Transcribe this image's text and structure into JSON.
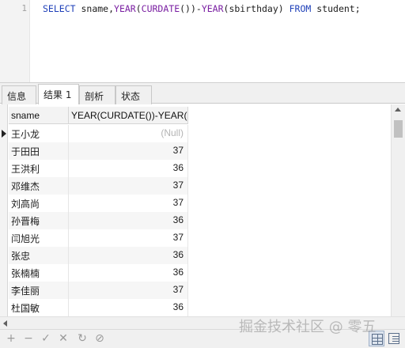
{
  "editor": {
    "line_number": "1",
    "sql": {
      "select": "SELECT",
      "columns": " sname,",
      "year_fn1": "YEAR",
      "open1": "(",
      "curdate_fn": "CURDATE",
      "call": "())-",
      "year_fn2": "YEAR",
      "arg": "(sbirthday) ",
      "from": "FROM",
      "table": " student;"
    }
  },
  "tabs": [
    {
      "label": "信息"
    },
    {
      "label": "结果 1",
      "active": true
    },
    {
      "label": "剖析"
    },
    {
      "label": "状态"
    }
  ],
  "grid": {
    "columns": [
      "sname",
      "YEAR(CURDATE())-YEAR(s"
    ],
    "rows": [
      {
        "sname": "王小龙",
        "age": "(Null)",
        "is_null": true
      },
      {
        "sname": "于田田",
        "age": "37"
      },
      {
        "sname": "王洪利",
        "age": "36"
      },
      {
        "sname": "邓维杰",
        "age": "37"
      },
      {
        "sname": "刘高尚",
        "age": "37"
      },
      {
        "sname": "孙晋梅",
        "age": "36"
      },
      {
        "sname": "闫旭光",
        "age": "37"
      },
      {
        "sname": "张忠",
        "age": "36"
      },
      {
        "sname": "张楠楠",
        "age": "36"
      },
      {
        "sname": "李佳丽",
        "age": "37"
      },
      {
        "sname": "杜国敏",
        "age": "36"
      }
    ],
    "current_row_index": 0
  },
  "toolbar": {
    "add": "+",
    "remove": "−",
    "apply": "✓",
    "discard": "✕",
    "refresh": "↻",
    "stop": "⊘",
    "icons": [
      "add-icon",
      "remove-icon",
      "check-icon",
      "close-icon",
      "refresh-icon",
      "stop-icon",
      "grid-view-icon",
      "form-view-icon"
    ]
  },
  "watermark": "掘金技术社区 @ 零五",
  "colors": {
    "keyword": "#1e3fb8",
    "function": "#7a1fa2",
    "null_text": "#b4b4b4"
  }
}
